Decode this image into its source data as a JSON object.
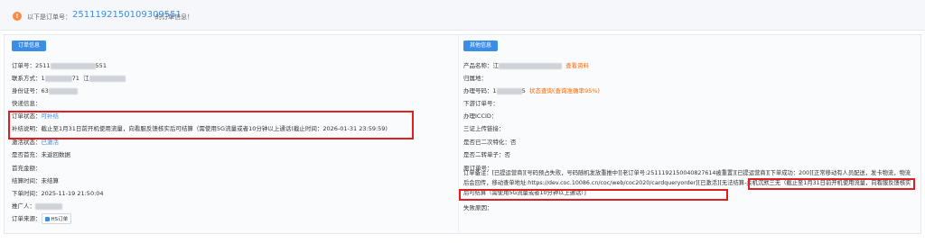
{
  "header": {
    "icon": "exclamation-icon",
    "label": "以下是订单号：",
    "order_no": "2511192150109309551",
    "suffix": "的订单信息！"
  },
  "left": {
    "section_title": "订单信息",
    "order_no_label": "订单号：",
    "order_no_value": "2511",
    "order_no_tail": "551",
    "contact_label": "联系方式：",
    "contact_value_a": "1",
    "contact_value_b": "71",
    "contact_value_c": "江",
    "id_label": "身份证号：",
    "id_value": "63",
    "express_label": "快递信息：",
    "status_label": "订单状态：",
    "status_value": "可补结",
    "reason_label": "补结说明：",
    "reason_value": "截止至1月31日前开机使用流量，向看服反馈核实后可结算（需使用5G流量或者10分钟以上通话(截止时间：2026-01-31 23:59:59)",
    "activate_label": "激活状态：",
    "activate_value": "已激活",
    "recharge_label": "是否首充：",
    "recharge_value": "未返回数据",
    "first_amount_label": "首充金额：",
    "settle_label": "结算时间：",
    "settle_value": "未结算",
    "order_time_label": "下单时间：",
    "order_time_value": "2025-11-19 21:50:04",
    "promoter_label": "推广人：",
    "source_label": "订单来源：",
    "source_badge": "HS订单"
  },
  "right": {
    "section_title": "其他信息",
    "product_label": "产品名称：",
    "product_value": "江",
    "product_link": "查看资料",
    "attr_label": "归属地：",
    "phone_label": "办理号码：",
    "phone_value": "1",
    "phone_tail": "5",
    "phone_status": "状态查询(查询准确率95%)",
    "down_order_label": "下游订单号：",
    "iccid_label": "办理ICCID：",
    "upload_label": "三证上传链接：",
    "secondary_label": "是否已二次特化：",
    "secondary_value": "否",
    "transfer_label": "是否二转单子：",
    "transfer_value": "否",
    "origin_label": "原订单号：",
    "remark_label": "订单备注：",
    "remark_text": "[已提运营商][号码预占失败，号码随机发放重推中][老订单号:2511192150040827614被重置][已提运营商][下单成功：200][正常移动有人员配送，发卡物流，物流后会回传，移动查单地址:https://dev.coc.10086.cn/coc/web/coc2020/cardqueryorder][已激活]",
    "remark_highlight_1": "[无法结算-关机沉默三无（截止至1月31日前开机使用流",
    "remark_highlight_2": "量，向看服反馈核实后可结算（需使用5G流量或者10分钟以上通话）]",
    "fail_label": "失败原因："
  }
}
